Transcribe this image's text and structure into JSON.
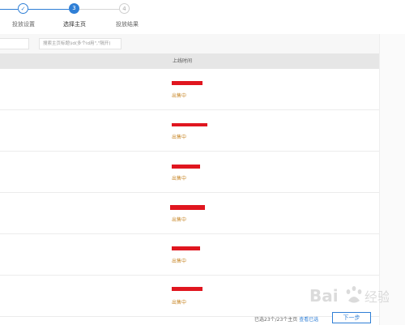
{
  "stepper": {
    "steps": [
      {
        "number": "✓",
        "label": "投放设置",
        "state": "done"
      },
      {
        "number": "3",
        "label": "选择主页",
        "state": "active"
      },
      {
        "number": "4",
        "label": "投放结果",
        "state": "todo"
      }
    ]
  },
  "filter": {
    "search_placeholder": "搜索主页标题\\id(多个id用\",\"隔开)"
  },
  "table": {
    "column_update_time": "上线时间",
    "rows": [
      {
        "status": "出售中"
      },
      {
        "status": "出售中"
      },
      {
        "status": "出售中"
      },
      {
        "status": "出售中"
      },
      {
        "status": "出售中"
      },
      {
        "status": "出售中"
      }
    ]
  },
  "footer": {
    "selected_text": "已选23个/23个主页",
    "view_selected_link": "查看已选",
    "next_button": "下一步"
  },
  "watermark": {
    "text": "Bai 经验"
  },
  "colors": {
    "accent": "#2f7fd6",
    "status": "#c8882a",
    "redaction": "#e0161f"
  }
}
